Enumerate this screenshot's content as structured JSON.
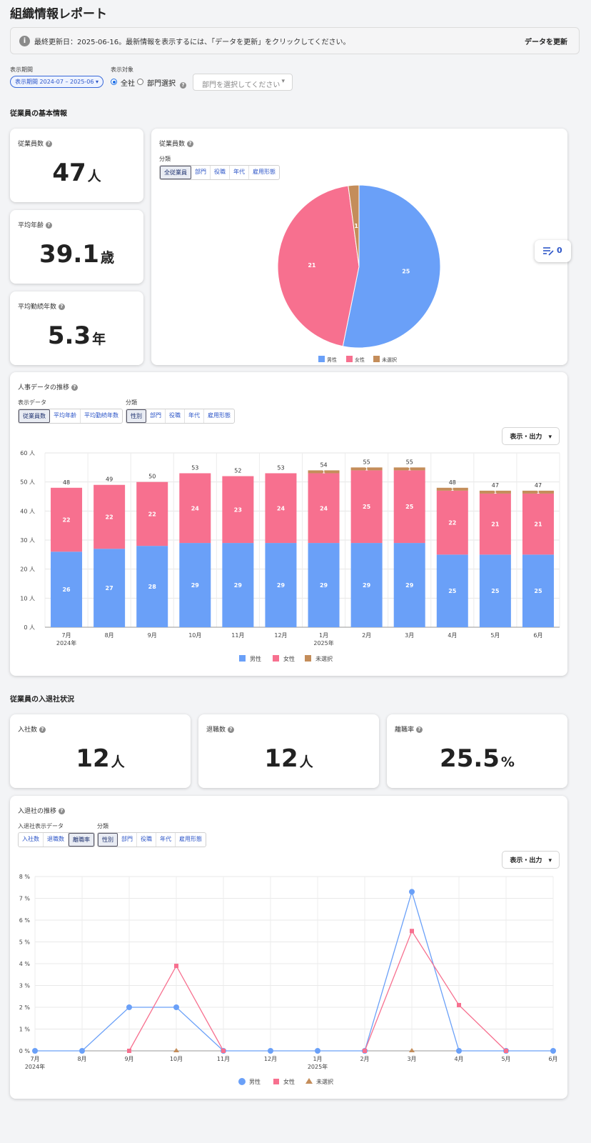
{
  "page_title": "組織情報レポート",
  "banner": {
    "text": "最終更新日：2025-06-16。最新情報を表示するには、「データを更新」をクリックしてください。",
    "button": "データを更新",
    "icon": "info-icon"
  },
  "filters": {
    "period_label": "表示期間",
    "period_value": "表示期間 2024-07 – 2025-06",
    "target_label": "表示対象",
    "radio_all": "全社",
    "radio_dept": "部門選択",
    "dept_placeholder": "部門を選択してください"
  },
  "basic": {
    "title": "従業員の基本情報",
    "employees": {
      "label": "従業員数",
      "value": "47",
      "unit": "人"
    },
    "avg_age": {
      "label": "平均年齢",
      "value": "39.1",
      "unit": "歳"
    },
    "tenure": {
      "label": "平均勤続年数",
      "value": "5.3",
      "unit": "年"
    }
  },
  "pie_card": {
    "title": "従業員数",
    "category_label": "分類",
    "tabs": [
      "全従業員",
      "部門",
      "役職",
      "年代",
      "雇用形態"
    ],
    "active_tab": 0
  },
  "float_button": {
    "count": "0",
    "icon": "edit-list-icon"
  },
  "trend": {
    "title": "人事データの推移",
    "data_label": "表示データ",
    "data_tabs": [
      "従業員数",
      "平均年齢",
      "平均勤続年数"
    ],
    "category_label": "分類",
    "category_tabs": [
      "性別",
      "部門",
      "役職",
      "年代",
      "雇用形態"
    ],
    "export_button": "表示・出力"
  },
  "turnover": {
    "title": "従業員の入退社状況",
    "hires": {
      "label": "入社数",
      "value": "12",
      "unit": "人"
    },
    "leavers": {
      "label": "退職数",
      "value": "12",
      "unit": "人"
    },
    "rate": {
      "label": "離職率",
      "value": "25.5",
      "unit": "%"
    }
  },
  "turnover_trend": {
    "title": "入退社の推移",
    "data_label": "入退社表示データ",
    "data_tabs": [
      "入社数",
      "退職数",
      "離職率"
    ],
    "category_label": "分類",
    "category_tabs": [
      "性別",
      "部門",
      "役職",
      "年代",
      "雇用形態"
    ],
    "export_button": "表示・出力"
  },
  "colors": {
    "male": "#6aa0f8",
    "female": "#f7708f",
    "unselected": "#c48d5a",
    "accent": "#2d56c8"
  },
  "chart_data": [
    {
      "type": "pie",
      "labels": [
        "男性",
        "女性",
        "未選択"
      ],
      "values": [
        25,
        21,
        1
      ]
    },
    {
      "type": "bar",
      "stacked": true,
      "categories": [
        "7月",
        "8月",
        "9月",
        "10月",
        "11月",
        "12月",
        "1月",
        "2月",
        "3月",
        "4月",
        "5月",
        "6月"
      ],
      "year_labels": {
        "0": "2024年",
        "6": "2025年"
      },
      "series": [
        {
          "name": "男性",
          "values": [
            26,
            27,
            28,
            29,
            29,
            29,
            29,
            29,
            29,
            25,
            25,
            25
          ]
        },
        {
          "name": "女性",
          "values": [
            22,
            22,
            22,
            24,
            23,
            24,
            24,
            25,
            25,
            22,
            21,
            21
          ]
        },
        {
          "name": "未選択",
          "values": [
            0,
            0,
            0,
            0,
            0,
            0,
            1,
            1,
            1,
            1,
            1,
            1
          ]
        }
      ],
      "totals": [
        48,
        49,
        50,
        53,
        52,
        53,
        54,
        55,
        55,
        48,
        47,
        47
      ],
      "yticks": [
        "0 人",
        "10 人",
        "20 人",
        "30 人",
        "40 人",
        "50 人",
        "60 人"
      ],
      "ylim": [
        0,
        60
      ],
      "legend_position": "bottom"
    },
    {
      "type": "line",
      "categories": [
        "7月",
        "8月",
        "9月",
        "10月",
        "11月",
        "12月",
        "1月",
        "2月",
        "3月",
        "4月",
        "5月",
        "6月"
      ],
      "year_labels": {
        "0": "2024年",
        "6": "2025年"
      },
      "series": [
        {
          "name": "男性",
          "values": [
            0,
            0,
            2,
            2,
            0,
            0,
            0,
            0,
            7.3,
            0,
            0,
            0
          ]
        },
        {
          "name": "女性",
          "values": [
            null,
            null,
            0,
            3.9,
            0,
            null,
            null,
            0,
            5.5,
            2.1,
            0,
            null
          ]
        },
        {
          "name": "未選択",
          "values": [
            null,
            null,
            null,
            0,
            null,
            null,
            null,
            null,
            0,
            null,
            null,
            null
          ]
        }
      ],
      "yticks": [
        "0 %",
        "1 %",
        "2 %",
        "3 %",
        "4 %",
        "5 %",
        "6 %",
        "7 %",
        "8 %"
      ],
      "ylim": [
        0,
        8
      ],
      "grid": true,
      "legend_position": "bottom"
    }
  ]
}
